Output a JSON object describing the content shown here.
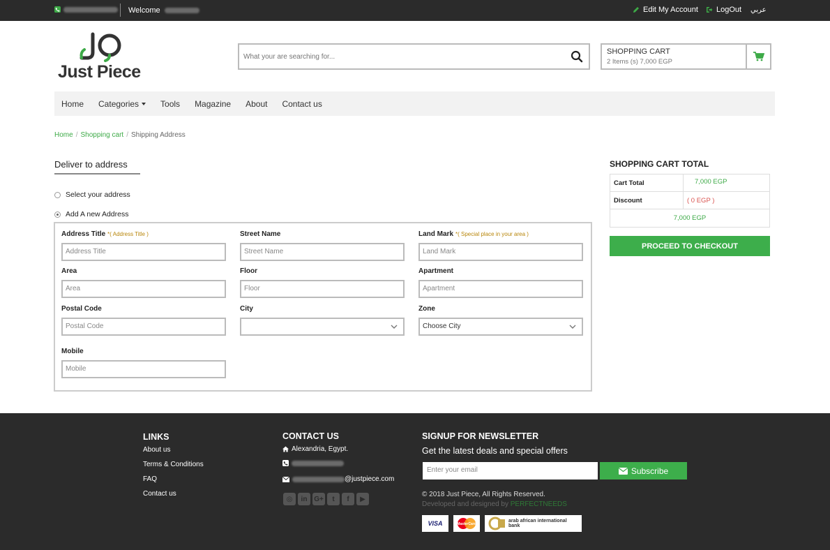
{
  "topbar": {
    "welcome": "Welcome",
    "edit_account": "Edit My Account",
    "logout": "LogOut",
    "language": "عربي"
  },
  "brand": {
    "name": "Just Piece"
  },
  "search": {
    "placeholder": "What your are searching for..."
  },
  "cart": {
    "title": "SHOPPING CART",
    "summary": "2 Items (s) 7,000 EGP"
  },
  "nav": {
    "items": [
      "Home",
      "Categories",
      "Tools",
      "Magazine",
      "About",
      "Contact us"
    ]
  },
  "breadcrumb": {
    "home": "Home",
    "cart": "Shopping cart",
    "current": "Shipping Address"
  },
  "deliver": {
    "title": "Deliver to address",
    "option_select": "Select your address",
    "option_new": "Add A new Address"
  },
  "form": {
    "address_title": {
      "label": "Address Title",
      "hint": "*( Address Title )",
      "placeholder": "Address Title"
    },
    "street": {
      "label": "Street Name",
      "placeholder": "Street Name"
    },
    "landmark": {
      "label": "Land Mark",
      "hint": "*( Special place in your area )",
      "placeholder": "Land Mark"
    },
    "area": {
      "label": "Area",
      "placeholder": "Area"
    },
    "floor": {
      "label": "Floor",
      "placeholder": "Floor"
    },
    "apartment": {
      "label": "Apartment",
      "placeholder": "Apartment"
    },
    "postal": {
      "label": "Postal Code",
      "placeholder": "Postal Code"
    },
    "city": {
      "label": "City",
      "value": ""
    },
    "zone": {
      "label": "Zone",
      "value": "Choose City"
    },
    "mobile": {
      "label": "Mobile",
      "placeholder": "Mobile"
    }
  },
  "totals": {
    "title": "SHOPPING CART TOTAL",
    "cart_total_label": "Cart Total",
    "cart_total_value": "7,000 EGP",
    "discount_label": "Discount",
    "discount_value": "( 0 EGP )",
    "grand_total": "7,000 EGP",
    "checkout_label": "PROCEED TO CHECKOUT"
  },
  "footer": {
    "links_title": "LINKS",
    "links": [
      "About us",
      "Terms & Conditions",
      "FAQ",
      "Contact us"
    ],
    "contact_title": "CONTACT US",
    "address": "Alexandria, Egypt.",
    "email_domain": "@justpiece.com",
    "newsletter_title": "SIGNUP FOR NEWSLETTER",
    "newsletter_sub": "Get the latest deals and special offers",
    "email_placeholder": "Enter your email",
    "subscribe_label": "Subscribe",
    "copyright": "© 2018 Just Piece, All Rights Reserved.",
    "developed": "Developed and designed by",
    "developer": "PERFECTNEEDS",
    "payment": [
      "VISA",
      "MasterCard",
      "arab african international bank"
    ]
  },
  "colors": {
    "brand_green": "#3dae4b",
    "dark": "#2b2b2b",
    "hint": "#b8860b",
    "discount": "#d9534f"
  }
}
